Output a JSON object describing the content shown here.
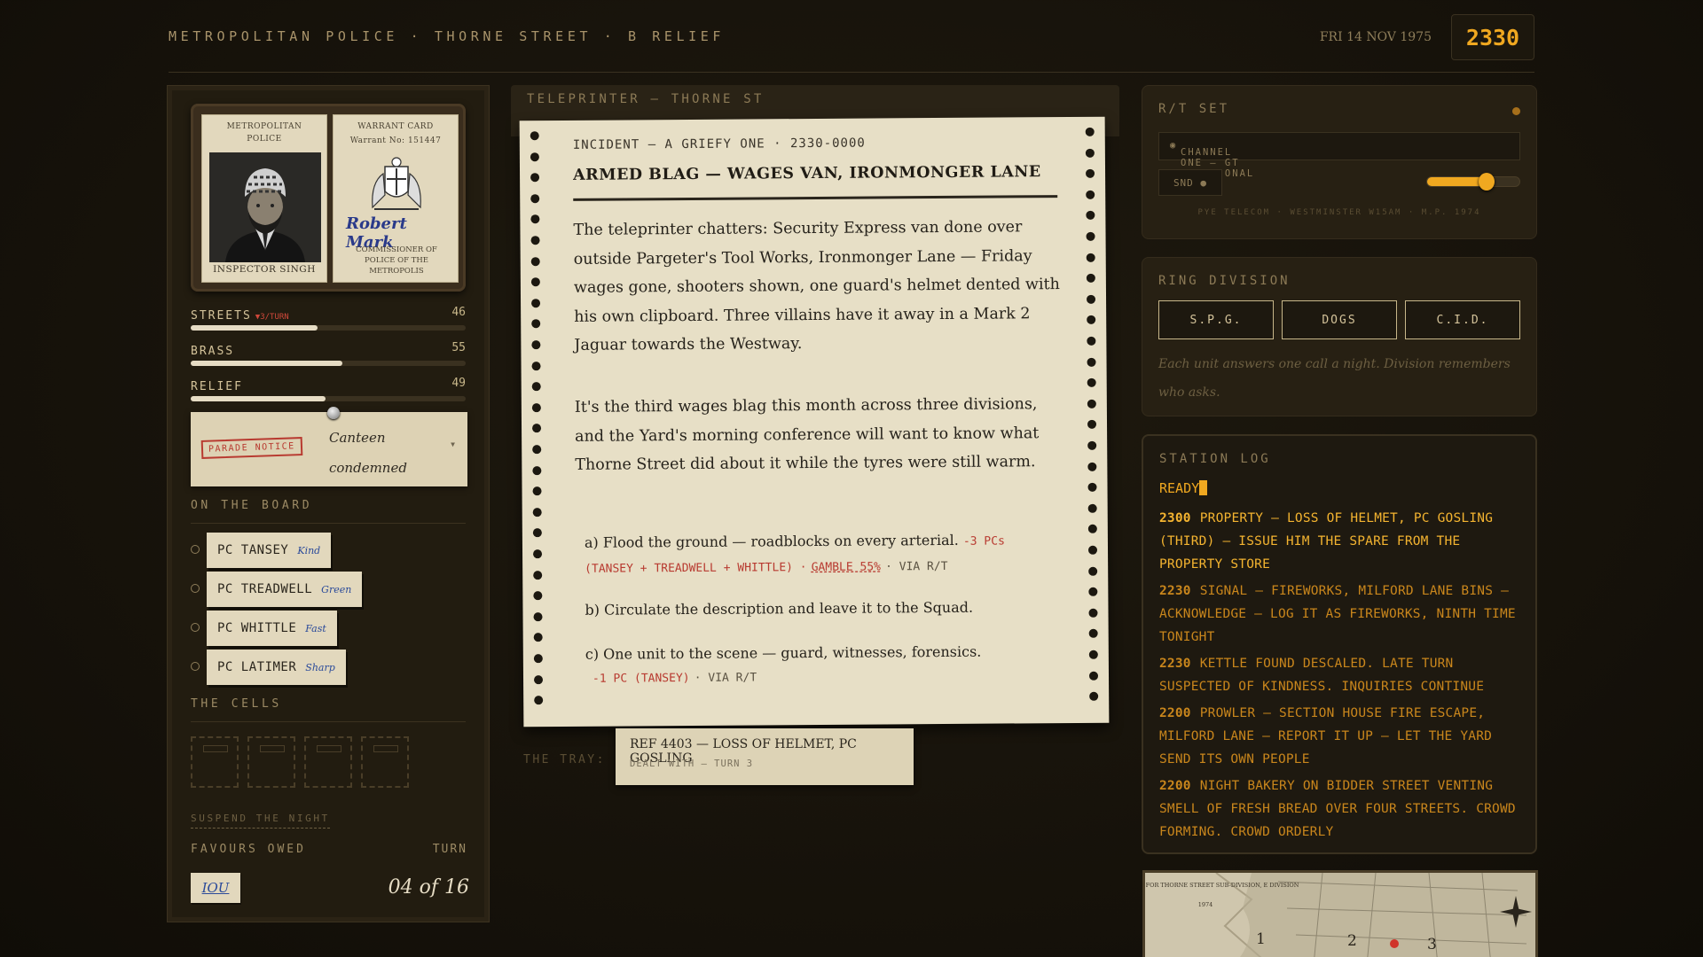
{
  "header": {
    "title": "METROPOLITAN POLICE · THORNE STREET · B RELIEF",
    "date": "FRI 14 NOV 1975",
    "clock": "2330"
  },
  "id_wallet": {
    "warrant_left_caption": "METROPOLITAN POLICE",
    "officer_name": "INSPECTOR SINGH",
    "warrant_right_caption": "WARRANT CARD",
    "warrant_no": "Warrant No: 151447",
    "signature": "Robert Mark",
    "commissioner": "COMMISSIONER OF POLICE OF THE METROPOLIS"
  },
  "stats": [
    {
      "label": "STREETS",
      "trend": "▼3/TURN",
      "value": "46",
      "level": 0.46
    },
    {
      "label": "BRASS",
      "trend": "",
      "value": "55",
      "level": 0.55
    },
    {
      "label": "RELIEF",
      "trend": "",
      "value": "49",
      "level": 0.49
    }
  ],
  "parade_notice": {
    "stamp": "PARADE NOTICE",
    "text": "Canteen condemned",
    "dropdown_icon": "triangle-down-icon"
  },
  "board": {
    "heading": "ON THE BOARD",
    "officers": [
      {
        "name": "PC TANSEY",
        "trait": "Kind"
      },
      {
        "name": "PC TREADWELL",
        "trait": "Green"
      },
      {
        "name": "PC WHITTLE",
        "trait": "Fast"
      },
      {
        "name": "PC LATIMER",
        "trait": "Sharp"
      }
    ]
  },
  "cells_heading": "THE CELLS",
  "suspend_label": "SUSPEND THE NIGHT",
  "favours": {
    "label": "FAVOURS OWED",
    "iou": "IOU"
  },
  "turn": {
    "label": "TURN",
    "value": "04 of 16"
  },
  "teleprinter": {
    "heading": "TELEPRINTER — THORNE ST",
    "kicker": "INCIDENT — A GRIEFY ONE · 2330-0000",
    "title": "ARMED BLAG — WAGES VAN, IRONMONGER LANE",
    "para1": "The teleprinter chatters: Security Express van done over outside Pargeter's Tool Works, Ironmonger Lane — Friday wages gone, shooters shown, one guard's helmet dented with his own clipboard. Three villains have it away in a Mark 2 Jaguar towards the Westway.",
    "para2": "It's the third wages blag this month across three divisions, and the Yard's morning conference will want to know what Thorne Street did about it while the tyres were still warm.",
    "options": [
      {
        "text": "a) Flood the ground — roadblocks on every arterial.",
        "cost": "-3 PCs (TANSEY + TREADWELL + WHITTLE) ·",
        "gamble": "GAMBLE 55%",
        "via": "· VIA R/T"
      },
      {
        "text": "b) Circulate the description and leave it to the Squad.",
        "cost": "",
        "gamble": "",
        "via": ""
      },
      {
        "text": "c) One unit to the scene — guard, witnesses, forensics.",
        "cost": "-1 PC (TANSEY)",
        "gamble": "",
        "via": "· VIA R/T"
      }
    ]
  },
  "tray": {
    "label": "THE TRAY:",
    "ref": "REF 4403 — LOSS OF HELMET, PC GOSLING",
    "status": "DEALT WITH — TURN 3"
  },
  "rt_set": {
    "heading": "R/T SET",
    "channel": "CHANNEL ONE — GT DIVISIONAL",
    "snd": "SND ●",
    "volume": 0.64,
    "footer": "PYE TELECOM · WESTMINSTER W15AM · M.P. 1974"
  },
  "ring_division": {
    "heading": "RING DIVISION",
    "buttons": [
      "S.P.G.",
      "DOGS",
      "C.I.D."
    ],
    "note": "Each unit answers one call a night. Division remembers who asks."
  },
  "station_log": {
    "heading": "STATION LOG",
    "ready": "READY",
    "entries": [
      {
        "time": "2300",
        "text": "PROPERTY — LOSS OF HELMET, PC GOSLING (THIRD) — ISSUE HIM THE SPARE FROM THE PROPERTY STORE",
        "color": "#f4b430"
      },
      {
        "time": "2230",
        "text": "SIGNAL — FIREWORKS, MILFORD LANE BINS — ACKNOWLEDGE — LOG IT AS FIREWORKS, NINTH TIME TONIGHT",
        "color": "#c9861c"
      },
      {
        "time": "2230",
        "text": "KETTLE FOUND DESCALED. LATE TURN SUSPECTED OF KINDNESS. INQUIRIES CONTINUE",
        "color": "#c9861c"
      },
      {
        "time": "2200",
        "text": "PROWLER — SECTION HOUSE FIRE ESCAPE, MILFORD LANE — REPORT IT UP — LET THE YARD SEND ITS OWN PEOPLE",
        "color": "#c9861c"
      },
      {
        "time": "2200",
        "text": "NIGHT BAKERY ON BIDDER STREET VENTING SMELL OF FRESH BREAD OVER FOUR STREETS. CROWD FORMING. CROWD ORDERLY",
        "color": "#c9861c"
      }
    ]
  },
  "beat_map": {
    "title": "BEAT MAP FOR THORNE STREET SUB-DIVISION, E DIVISION",
    "year": "1974",
    "beats": [
      "1",
      "2",
      "3"
    ]
  }
}
